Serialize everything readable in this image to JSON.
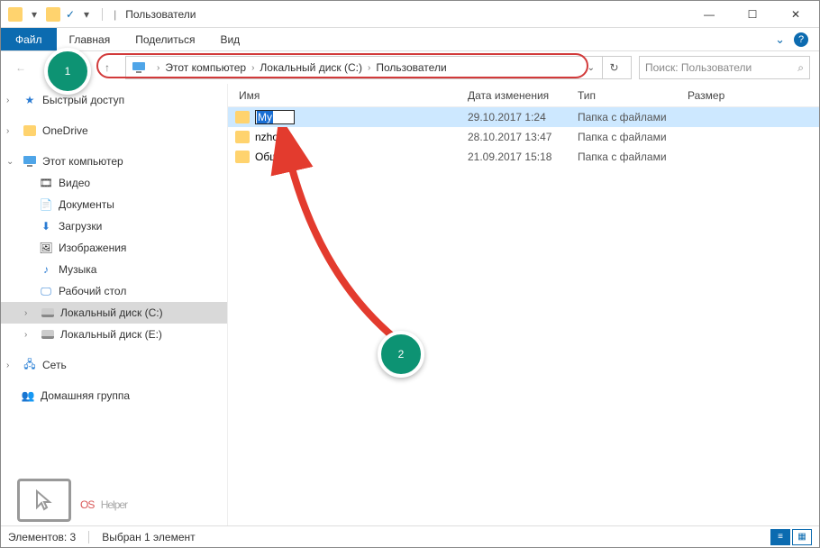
{
  "titlebar": {
    "title": "Пользователи"
  },
  "ribbon": {
    "file": "Файл",
    "tabs": [
      "Главная",
      "Поделиться",
      "Вид"
    ]
  },
  "breadcrumb": {
    "items": [
      "Этот компьютер",
      "Локальный диск (C:)",
      "Пользователи"
    ]
  },
  "search": {
    "placeholder": "Поиск: Пользователи"
  },
  "sidebar": {
    "quick": "Быстрый доступ",
    "onedrive": "OneDrive",
    "pc": "Этот компьютер",
    "videos": "Видео",
    "documents": "Документы",
    "downloads": "Загрузки",
    "images": "Изображения",
    "music": "Музыка",
    "desktop": "Рабочий стол",
    "diskc": "Локальный диск (C:)",
    "diske": "Локальный диск (E:)",
    "network": "Сеть",
    "homegroup": "Домашняя группа"
  },
  "columns": {
    "name": "Имя",
    "date": "Дата изменения",
    "type": "Тип",
    "size": "Размер"
  },
  "rows": [
    {
      "name": "My",
      "date": "29.10.2017 1:24",
      "type": "Папка с файлами",
      "rename": true
    },
    {
      "name": "nzho",
      "date": "28.10.2017 13:47",
      "type": "Папка с файлами"
    },
    {
      "name": "Общие",
      "date": "21.09.2017 15:18",
      "type": "Папка с файлами"
    }
  ],
  "statusbar": {
    "count": "Элементов: 3",
    "selected": "Выбран 1 элемент"
  },
  "anno": {
    "one": "1",
    "two": "2"
  },
  "watermark": {
    "os": "OS",
    "helper": "Helper"
  }
}
